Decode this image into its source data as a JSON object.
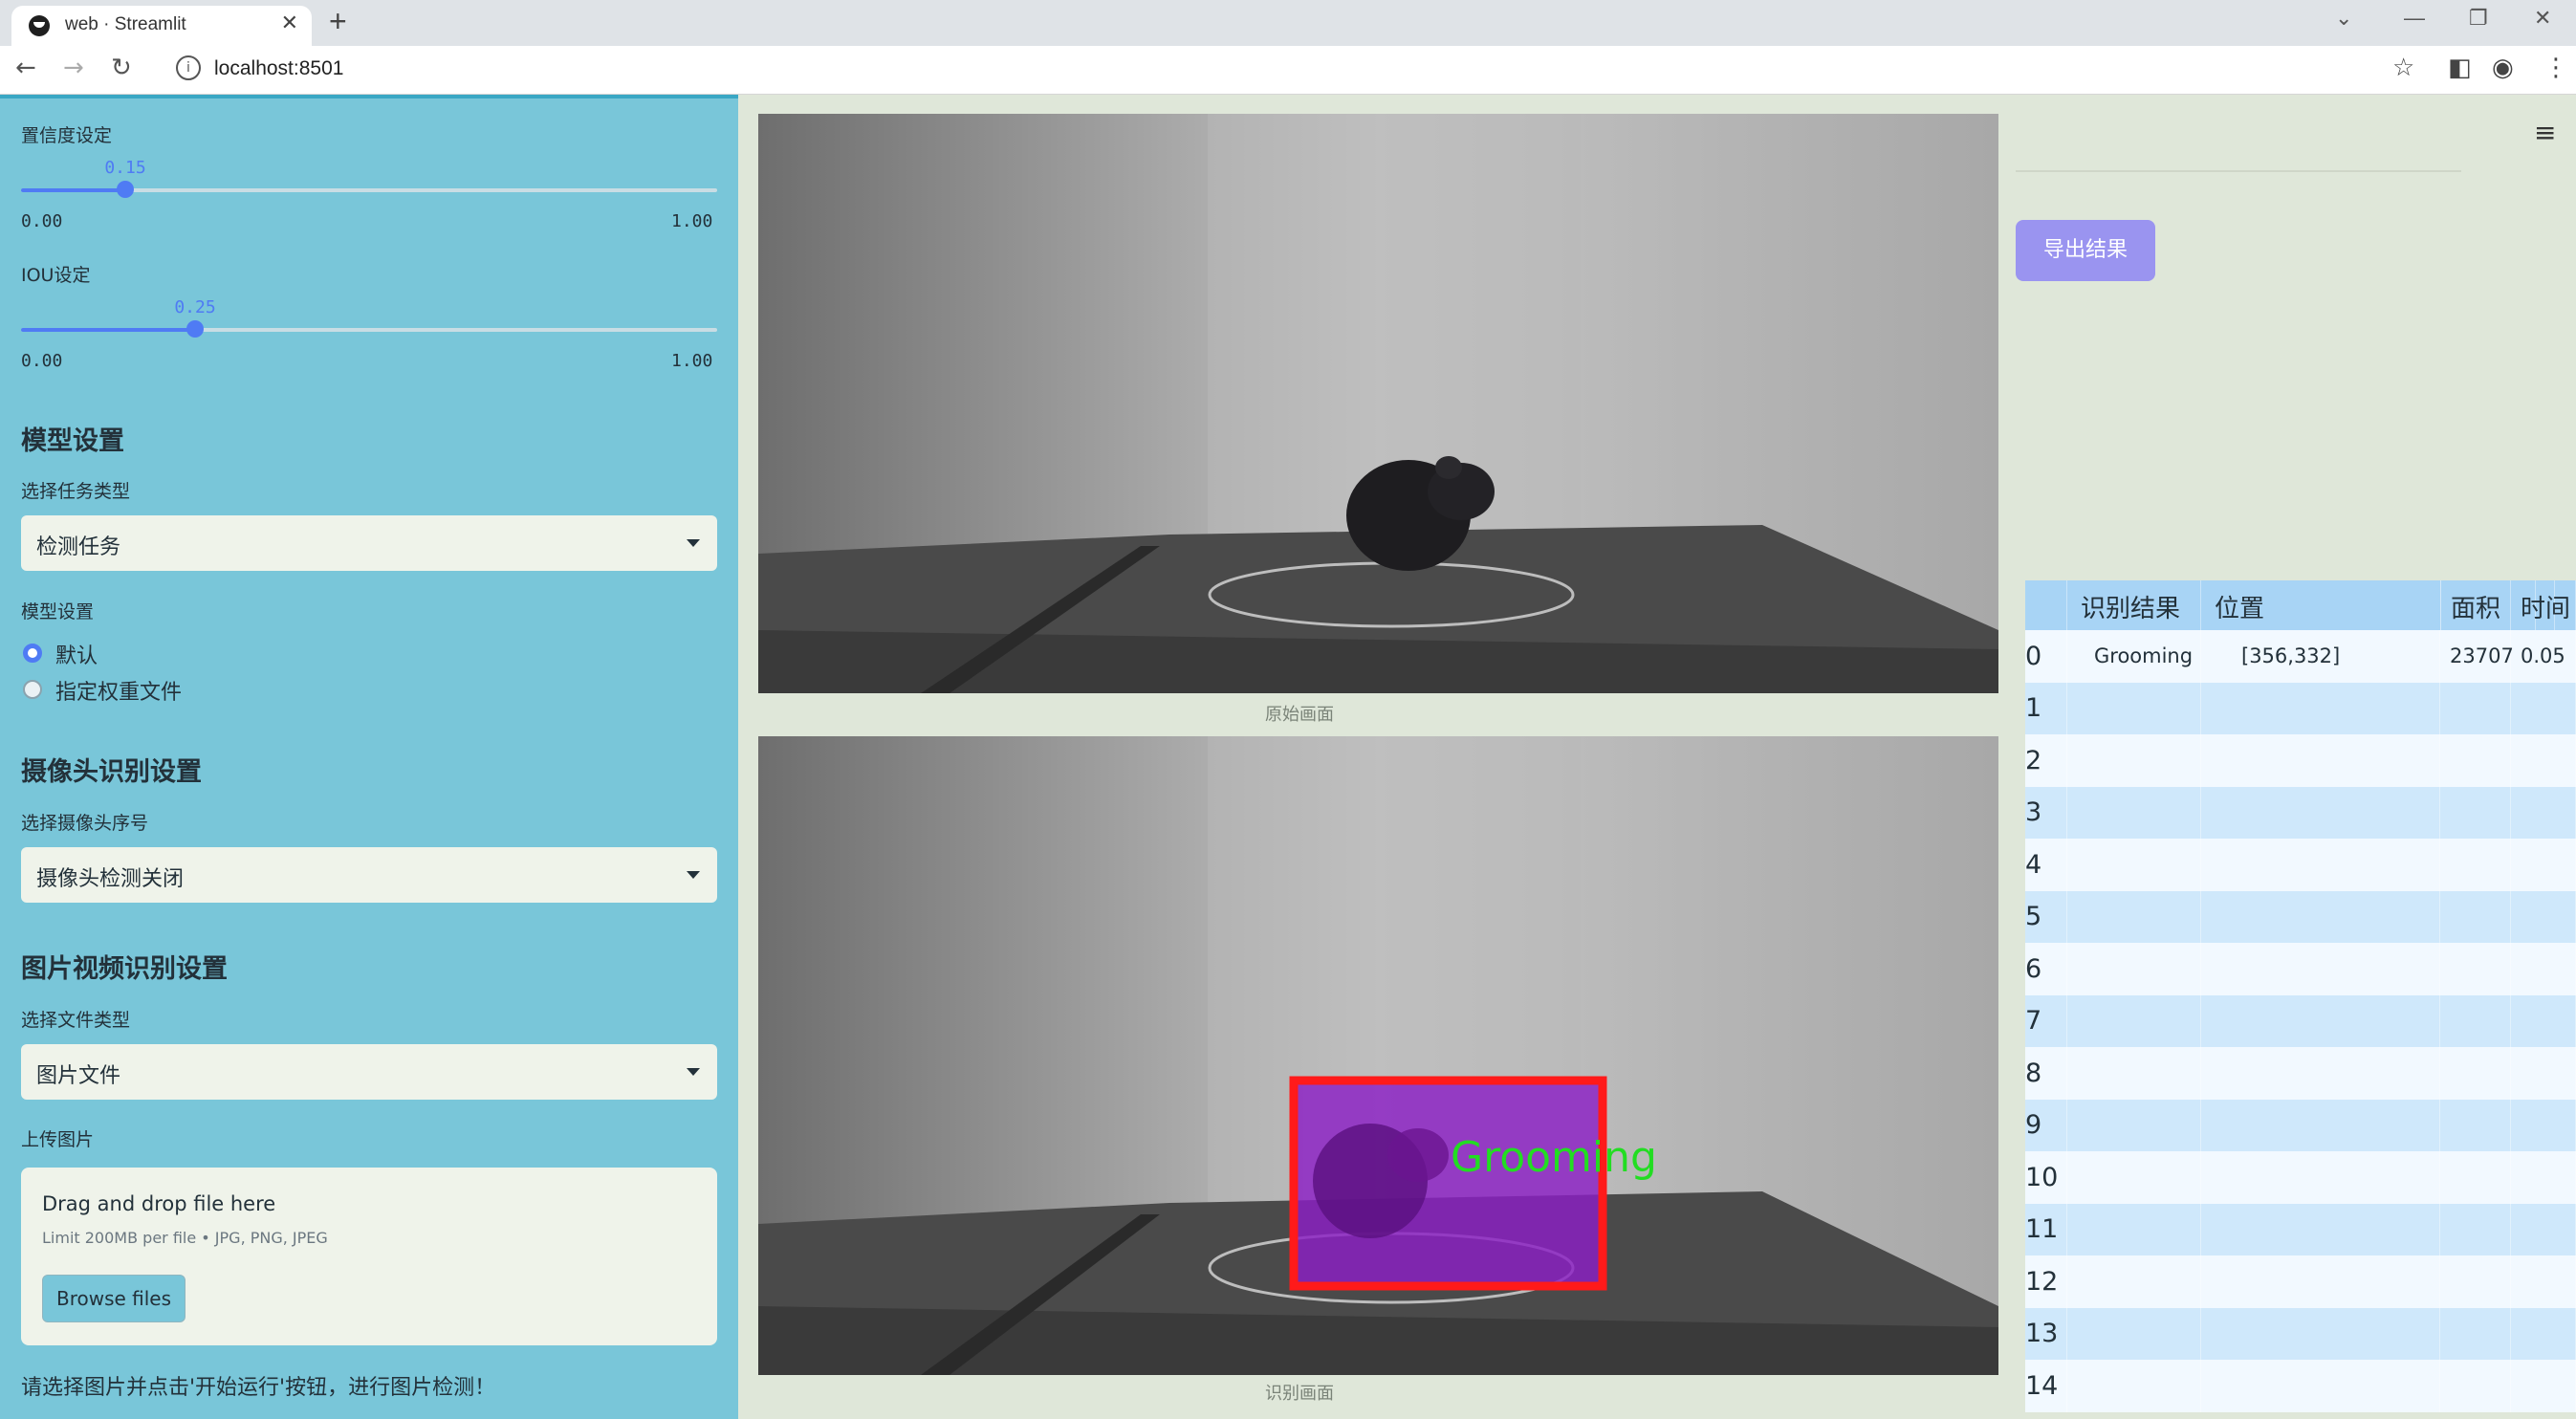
{
  "browser": {
    "tab_title": "web · Streamlit",
    "url": "localhost:8501"
  },
  "sidebar": {
    "confidence": {
      "label": "置信度设定",
      "value": "0.15",
      "fraction": 0.15,
      "min": "0.00",
      "max": "1.00"
    },
    "iou": {
      "label": "IOU设定",
      "value": "0.25",
      "fraction": 0.25,
      "min": "0.00",
      "max": "1.00"
    },
    "model_heading": "模型设置",
    "task_label": "选择任务类型",
    "task_value": "检测任务",
    "model_label": "模型设置",
    "model_options": [
      "默认",
      "指定权重文件"
    ],
    "model_selected": 0,
    "camera_heading": "摄像头识别设置",
    "camera_label": "选择摄像头序号",
    "camera_value": "摄像头检测关闭",
    "media_heading": "图片视频识别设置",
    "filetype_label": "选择文件类型",
    "filetype_value": "图片文件",
    "upload_label": "上传图片",
    "upload_title": "Drag and drop file here",
    "upload_limit": "Limit 200MB per file • JPG, PNG, JPEG",
    "browse_label": "Browse files",
    "hint": "请选择图片并点击'开始运行'按钮，进行图片检测！"
  },
  "main": {
    "original_caption": "原始画面",
    "result_caption": "识别画面",
    "detection_label": "Grooming",
    "export_label": "导出结果"
  },
  "table": {
    "headers": [
      "",
      "识别结果",
      "位置",
      "面积",
      "时间"
    ],
    "rows": [
      [
        "0",
        "Grooming",
        "[356,332]",
        "23707",
        "0.05"
      ],
      [
        "1",
        "",
        "",
        "",
        ""
      ],
      [
        "2",
        "",
        "",
        "",
        ""
      ],
      [
        "3",
        "",
        "",
        "",
        ""
      ],
      [
        "4",
        "",
        "",
        "",
        ""
      ],
      [
        "5",
        "",
        "",
        "",
        ""
      ],
      [
        "6",
        "",
        "",
        "",
        ""
      ],
      [
        "7",
        "",
        "",
        "",
        ""
      ],
      [
        "8",
        "",
        "",
        "",
        ""
      ],
      [
        "9",
        "",
        "",
        "",
        ""
      ],
      [
        "10",
        "",
        "",
        "",
        ""
      ],
      [
        "11",
        "",
        "",
        "",
        ""
      ],
      [
        "12",
        "",
        "",
        "",
        ""
      ],
      [
        "13",
        "",
        "",
        "",
        ""
      ],
      [
        "14",
        "",
        "",
        "",
        ""
      ]
    ]
  },
  "colors": {
    "sidebar_bg": "#79c6d9",
    "accent": "#4f7bf4",
    "export_button": "#9a94f0",
    "box_red": "#ff1a1a",
    "box_fill": "#8b1fc4",
    "label_green": "#22dd22",
    "row_alt": "#cfe8fb",
    "row_plain": "#f2f9ff",
    "header_bg": "#a8d4f5"
  }
}
